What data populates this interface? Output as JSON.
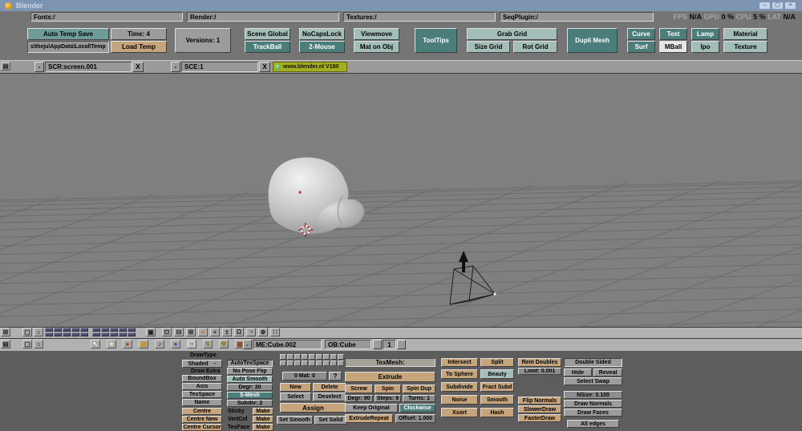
{
  "window": {
    "title": "Blender",
    "minimize": "–",
    "maximize": "▢",
    "close": "×"
  },
  "paths": {
    "fonts": "Fonts:/",
    "render": "Render:/",
    "textures": "Textures:/",
    "seqplugin": "SeqPlugin:/"
  },
  "perf": {
    "fps_label": "FPS",
    "fps_value": "N/A",
    "gpu_label": "GPU",
    "gpu_value": "0 %",
    "cpu_label": "CPU",
    "cpu_value": "5 %",
    "lat_label": "LAT",
    "lat_value": "N/A"
  },
  "prefs": {
    "auto_temp_save": "Auto Temp Save",
    "temp_path": "s\\theju\\AppData\\Local\\Temp",
    "time": "Time: 4",
    "load_temp": "Load Temp",
    "versions": "Versions: 1",
    "scene_global": "Scene Global",
    "nocapslock": "NoCapsLock",
    "viewmove": "Viewmove",
    "trackball": "TrackBall",
    "two_mouse": "2-Mouse",
    "mat_on_obj": "Mat on Obj",
    "tooltips": "ToolTips",
    "grab_grid": "Grab Grid",
    "size_grid": "Size Grid",
    "rot_grid": "Rot Grid",
    "dupli_mesh": "Dupli Mesh",
    "curve": "Curve",
    "text": "Text",
    "lamp": "Lamp",
    "material": "Material",
    "surf": "Surf",
    "mball": "MBall",
    "ipo": "Ipo",
    "texture": "Texture"
  },
  "screen_bar": {
    "screen_menu": "-",
    "screen": "SCR:screen.001",
    "screen_close": "X",
    "scene_menu": "-",
    "scene": "SCE:1",
    "scene_close": "X",
    "version_badge": "www.blender.nl V180"
  },
  "viewport_header": {
    "tools": [
      {
        "name": "local-view-icon",
        "glyph": "⊡"
      },
      {
        "name": "border-select-icon",
        "glyph": "⊟"
      },
      {
        "name": "face-select-icon",
        "glyph": "⊞"
      },
      {
        "name": "draw-ball-icon",
        "glyph": "●",
        "color": "#c87c28"
      },
      {
        "name": "translate-icon",
        "glyph": "+"
      },
      {
        "name": "scale-icon",
        "glyph": "±"
      },
      {
        "name": "rotate-icon",
        "glyph": "Ω"
      },
      {
        "name": "view-rotate-icon",
        "glyph": "◔"
      },
      {
        "name": "manipulator-icon",
        "glyph": "⊕"
      },
      {
        "name": "snap-icon",
        "glyph": "∷"
      }
    ]
  },
  "buttons_header": {
    "icons": [
      {
        "name": "view-pointer-icon",
        "glyph": "↖",
        "color": "#f2f2f2"
      },
      {
        "name": "lamp-buttons-icon",
        "glyph": "★",
        "color": "#ece4a6"
      },
      {
        "name": "material-buttons-icon",
        "glyph": "●",
        "color": "#b83028"
      },
      {
        "name": "texture-buttons-icon",
        "glyph": "▦",
        "color": "#d09020"
      },
      {
        "name": "anim-buttons-icon",
        "glyph": "♪",
        "color": "#1c1c1c"
      },
      {
        "name": "world-buttons-icon",
        "glyph": "●",
        "color": "#3050b8"
      },
      {
        "name": "edit-buttons-icon",
        "glyph": "○",
        "pressed": true
      },
      {
        "name": "script-buttons-icon",
        "glyph": "↯",
        "color": "#8a7a10"
      },
      {
        "name": "radiosity-buttons-icon",
        "glyph": "☢",
        "color": "#8a8410"
      },
      {
        "name": "image-buttons-icon",
        "glyph": "▦",
        "color": "#8a4828"
      }
    ],
    "menu": "-",
    "mesh_name": "ME:Cube.002",
    "object_name": "OB:Cube",
    "count": "1"
  },
  "panels": {
    "drawtype": {
      "title": "DrawType",
      "shaded": "Shaded",
      "draw_extra": "Draw Extra",
      "boundbox": "BoundBox",
      "axis": "Axis",
      "texspace": "TexSpace",
      "name": "Name",
      "centre": "Centre",
      "centre_new": "Centre New",
      "centre_cursor": "Centre Cursor"
    },
    "meshopts": {
      "autotexspace": "AutoTexSpace",
      "no_pose_flip": "No Pose Flip",
      "auto_smooth": "Auto Smooth",
      "degr": "Degr: 30",
      "smesh": "S-Mesh",
      "subdiv": "Subdiv: 2",
      "sticky": "Sticky",
      "vertcol": "VertCol",
      "texface": "TexFace",
      "make": "Make"
    },
    "material": {
      "mat_index": "0 Mat: 0",
      "help": "?",
      "new": "New",
      "delete": "Delete",
      "select": "Select",
      "deselect": "Deselect",
      "assign": "Assign",
      "set_smooth": "Set Smooth",
      "set_solid": "Set Solid"
    },
    "extrude_panel": {
      "texmesh": "TexMesh:",
      "extrude": "Extrude",
      "screw": "Screw",
      "spin": "Spin",
      "spin_dup": "Spin Dup",
      "degr": "Degr: 90",
      "steps": "Steps: 9",
      "turns": "Turns: 1",
      "keep_original": "Keep Original",
      "clockwise": "Clockwise",
      "extrude_repeat": "ExtrudeRepeat",
      "offset": "Offset: 1.000"
    },
    "tools": {
      "intersect": "Intersect",
      "split": "Split",
      "to_sphere": "To Sphere",
      "beauty": "Beauty",
      "subdivide": "Subdivide",
      "fract_subd": "Fract Subd",
      "noise": "Noise",
      "smooth": "Smooth",
      "xsort": "Xsort",
      "hash": "Hash"
    },
    "doubles": {
      "rem_doubles": "Rem Doubles",
      "limit": "Limit: 0.001",
      "flip_normals": "Flip Normals",
      "slower_draw": "SlowerDraw",
      "faster_draw": "FasterDraw"
    },
    "display": {
      "double_sided": "Double Sided",
      "hide": "Hide",
      "reveal": "Reveal",
      "select_swap": "Select Swap",
      "nsize": "NSize: 0.100",
      "draw_normals": "Draw Normals",
      "draw_faces": "Draw Faces",
      "all_edges": "All edges"
    }
  },
  "colors": {
    "teal_dark": "#4b7d7b",
    "teal_light": "#a3bdb9",
    "tan": "#c6a57c",
    "badge": "#a2ae20",
    "viewport_bg": "#7f7f7f",
    "grid_line": "#6c6c6c"
  }
}
